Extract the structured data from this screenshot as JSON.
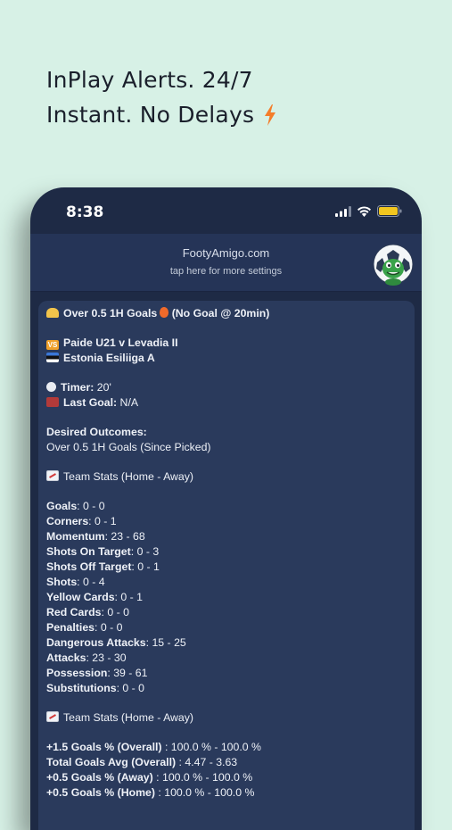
{
  "promo": {
    "line1": "InPlay Alerts. 24/7",
    "line2": "Instant. No Delays",
    "bolt_icon": "lightning-bolt-icon",
    "bolt_color": "#f47d2a"
  },
  "status_bar": {
    "time": "8:38",
    "battery_color": "#f2c61f"
  },
  "header": {
    "site": "FootyAmigo.com",
    "subtitle": "tap here for more settings",
    "logo_icon": "footyamigo-mascot-logo"
  },
  "alert": {
    "title": "Over 0.5 1H Goals",
    "title_suffix": "(No Goal @ 20min)",
    "match": "Paide U21 v Levadia II",
    "league": "Estonia Esiliiga A",
    "timer_label": "Timer:",
    "timer_value": " 20'",
    "last_goal_label": "Last Goal:",
    "last_goal_value": " N/A",
    "desired_label": "Desired Outcomes:",
    "desired_value": "Over 0.5 1H Goals (Since Picked)",
    "team_stats_heading": "Team Stats (Home - Away)",
    "stats": [
      {
        "label": "Goals",
        "value": ": 0 - 0"
      },
      {
        "label": "Corners",
        "value": ": 0 - 1"
      },
      {
        "label": "Momentum",
        "value": ": 23 - 68"
      },
      {
        "label": "Shots On Target",
        "value": ": 0 - 3"
      },
      {
        "label": "Shots Off Target",
        "value": ": 0 - 1"
      },
      {
        "label": "Shots",
        "value": ": 0 - 4"
      },
      {
        "label": "Yellow Cards",
        "value": ": 0 - 1"
      },
      {
        "label": "Red Cards",
        "value": ": 0 - 0"
      },
      {
        "label": "Penalties",
        "value": ": 0 - 0"
      },
      {
        "label": "Dangerous Attacks",
        "value": ": 15 - 25"
      },
      {
        "label": "Attacks",
        "value": ": 23 - 30"
      },
      {
        "label": "Possession",
        "value": ": 39 - 61"
      },
      {
        "label": "Substitutions",
        "value": ": 0 - 0"
      }
    ],
    "team_stats_heading2": "Team Stats (Home - Away)",
    "stats2": [
      {
        "label": "+1.5 Goals % (Overall)",
        "value": " : 100.0 % - 100.0 %"
      },
      {
        "label": "Total Goals Avg (Overall)",
        "value": " : 4.47 - 3.63"
      },
      {
        "label": "+0.5 Goals % (Away)",
        "value": " : 100.0 % - 100.0 %"
      },
      {
        "label": "+0.5 Goals % (Home)",
        "value": " : 100.0 % - 100.0 %"
      }
    ]
  }
}
